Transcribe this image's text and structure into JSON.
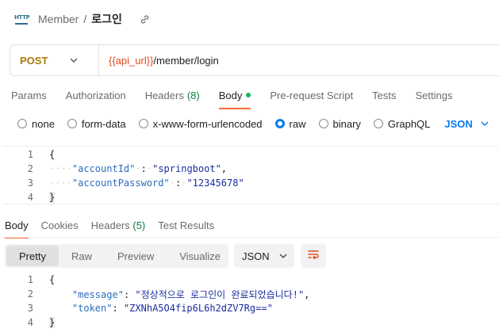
{
  "breadcrumb": {
    "icon_text": "HTTP",
    "parent": "Member",
    "separator": "/",
    "current": "로그인"
  },
  "request": {
    "method": "POST",
    "url_variable": "{{api_url}}",
    "url_path": "/member/login"
  },
  "request_tabs": [
    {
      "label": "Params"
    },
    {
      "label": "Authorization"
    },
    {
      "label": "Headers",
      "count": "(8)"
    },
    {
      "label": "Body",
      "active": true
    },
    {
      "label": "Pre-request Script"
    },
    {
      "label": "Tests"
    },
    {
      "label": "Settings"
    }
  ],
  "body_types": {
    "options": [
      "none",
      "form-data",
      "x-www-form-urlencoded",
      "raw",
      "binary",
      "GraphQL"
    ],
    "selected": "raw",
    "format": "JSON"
  },
  "request_body": {
    "line_numbers": [
      "1",
      "2",
      "3",
      "4"
    ],
    "open_brace": "{",
    "close_brace": "}",
    "fields": [
      {
        "key": "\"accountId\"",
        "colon": ":",
        "value": "\"springboot\"",
        "trail": ","
      },
      {
        "key": "\"accountPassword\"",
        "colon": ":",
        "value": "\"12345678\"",
        "trail": ""
      }
    ]
  },
  "response_tabs": [
    {
      "label": "Body",
      "active": true
    },
    {
      "label": "Cookies"
    },
    {
      "label": "Headers",
      "count": "(5)"
    },
    {
      "label": "Test Results"
    }
  ],
  "response_view": {
    "modes": [
      "Pretty",
      "Raw",
      "Preview",
      "Visualize"
    ],
    "selected": "Pretty",
    "format": "JSON"
  },
  "response_body": {
    "line_numbers": [
      "1",
      "2",
      "3",
      "4"
    ],
    "open_brace": "{",
    "close_brace": "}",
    "fields": [
      {
        "key": "\"message\"",
        "colon": ":",
        "value": "\"정상적으로 로그인이 완료되었습니다!\"",
        "trail": ","
      },
      {
        "key": "\"token\"",
        "colon": ":",
        "value": "\"ZXNhA5O4fip6L6h2dZV7Rg==\"",
        "trail": ""
      }
    ]
  },
  "colors": {
    "method": "#ad7a03",
    "url_variable": "#e0481c",
    "active_tab_underline": "#ff6c37",
    "count": "#0c7d3e",
    "radio_selected": "#097bed",
    "json_key": "#2c6dbd",
    "json_string": "#1c2d9f"
  },
  "icons": {
    "request_type": "http-icon",
    "copy_link": "link-icon",
    "method_dropdown": "chevron-down-icon",
    "format_dropdown": "chevron-down-icon",
    "wrap": "wrap-lines-icon"
  }
}
